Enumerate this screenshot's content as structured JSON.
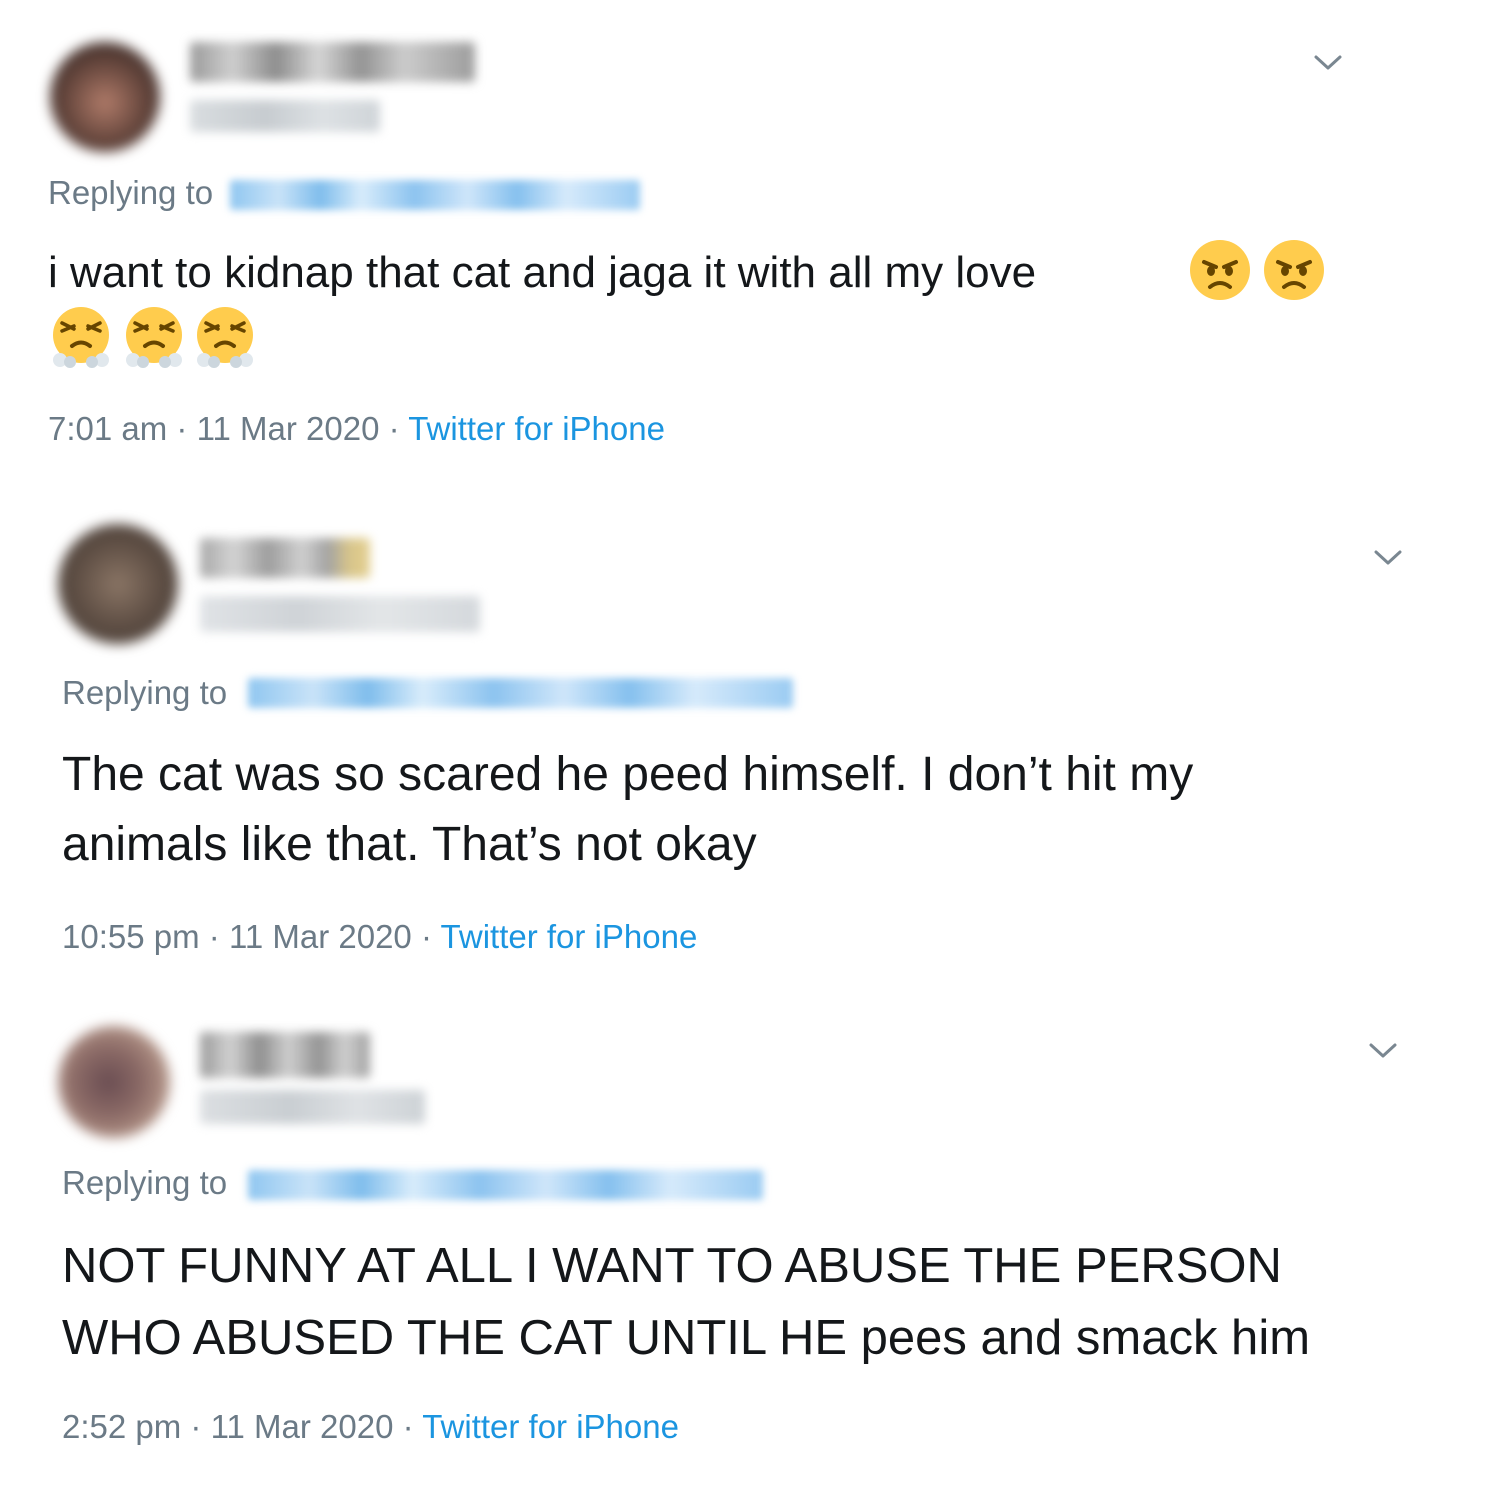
{
  "tweets": [
    {
      "replying_label": "Replying to",
      "text_lines": [
        "i want to kidnap that cat and jaga it with all my love"
      ],
      "emoji_row1": [
        "angry-face",
        "angry-face"
      ],
      "emoji_row2": [
        "face-with-steam",
        "face-with-steam",
        "face-with-steam"
      ],
      "time": "7:01 am",
      "date": "11 Mar 2020",
      "source": "Twitter for iPhone"
    },
    {
      "replying_label": "Replying to",
      "text_lines": [
        "The cat was so scared he peed himself. I don’t hit my",
        "animals like that. That’s not okay"
      ],
      "time": "10:55 pm",
      "date": "11 Mar 2020",
      "source": "Twitter for iPhone"
    },
    {
      "replying_label": "Replying to",
      "text_lines": [
        "NOT FUNNY AT ALL I WANT TO ABUSE THE PERSON",
        "WHO ABUSED THE CAT UNTIL HE pees and smack him"
      ],
      "time": "2:52 pm",
      "date": "11 Mar 2020",
      "source": "Twitter for iPhone"
    }
  ],
  "separator": "·",
  "colors": {
    "text": "#14171a",
    "secondary": "#6b7a86",
    "link": "#1b95e0",
    "emoji_yellow": "#ffcc4d"
  }
}
